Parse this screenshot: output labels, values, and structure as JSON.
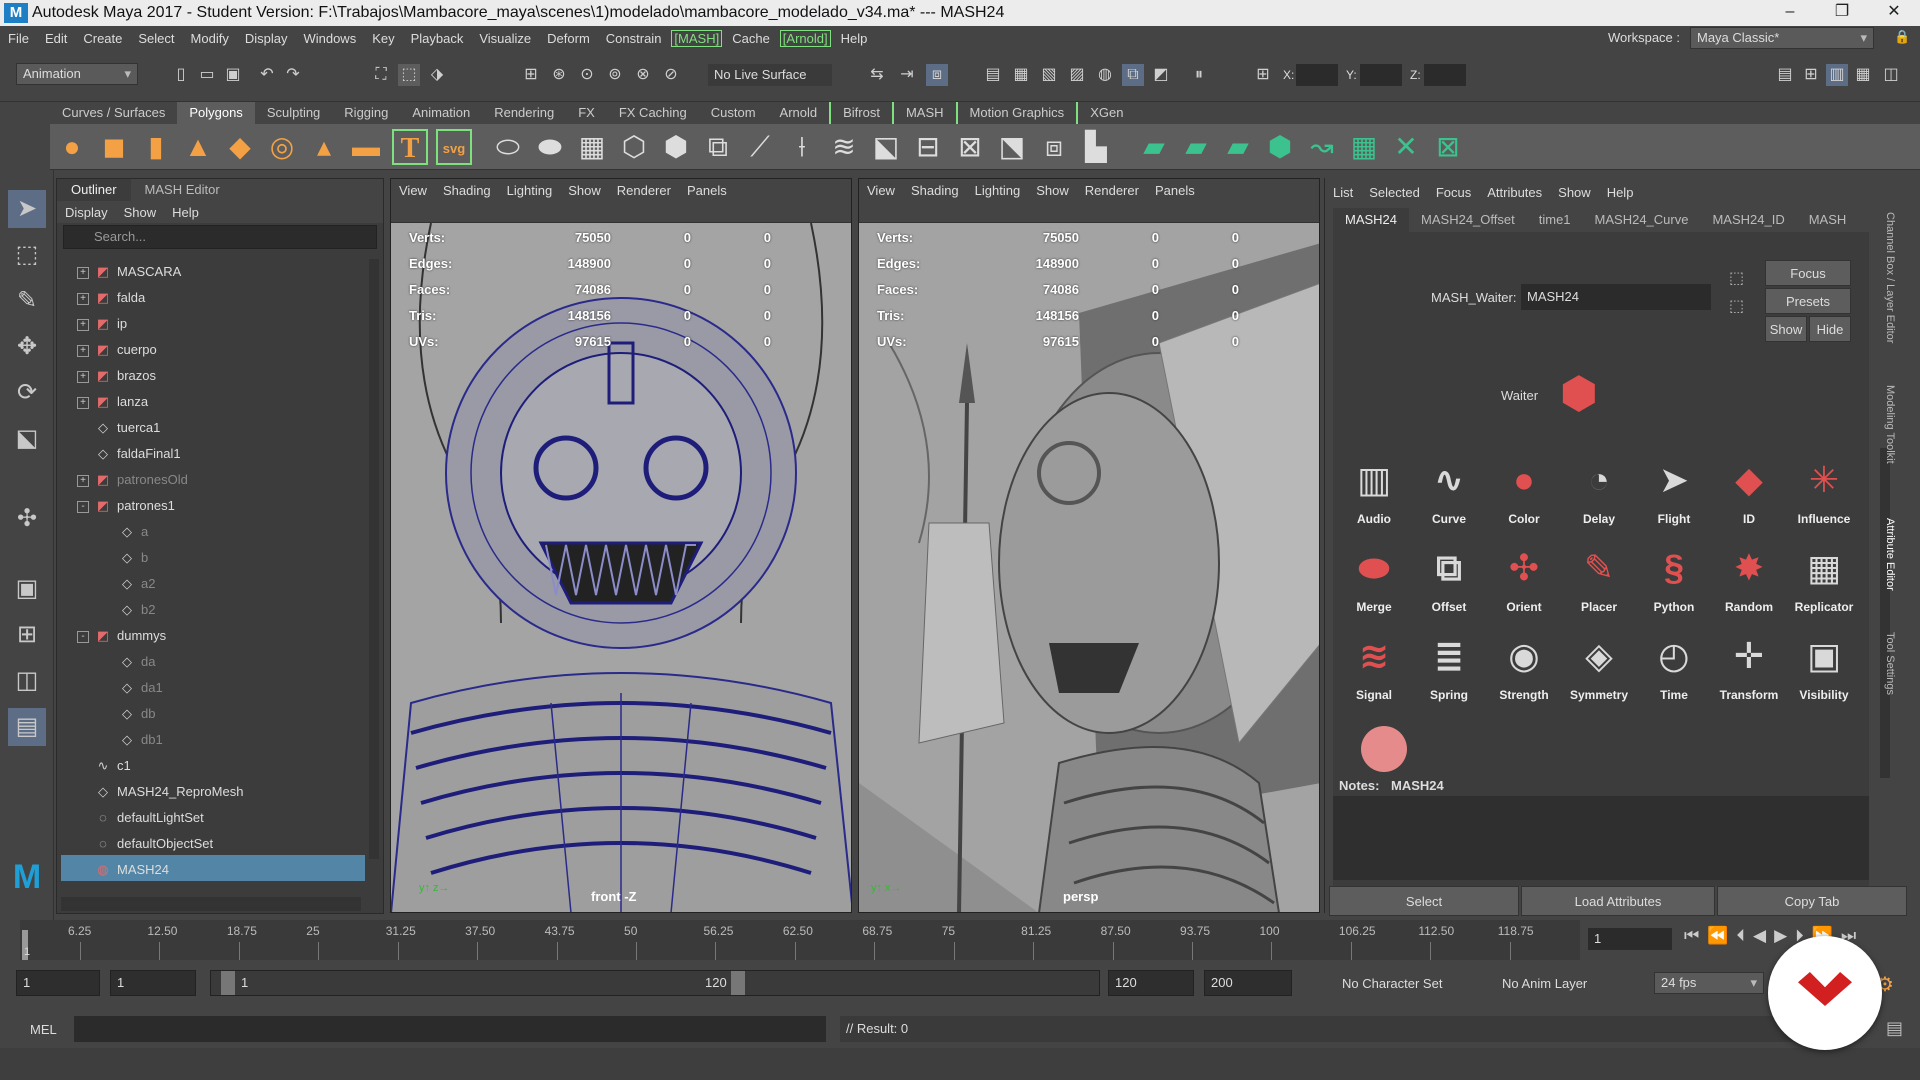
{
  "window": {
    "title": "Autodesk Maya 2017 - Student Version: F:\\Trabajos\\Mambacore_maya\\scenes\\1)modelado\\mambacore_modelado_v34.ma*   ---   MASH24",
    "app_logo": "M"
  },
  "menubar": {
    "items": [
      "File",
      "Edit",
      "Create",
      "Select",
      "Modify",
      "Display",
      "Windows",
      "Key",
      "Playback",
      "Visualize",
      "Deform",
      "Constrain",
      "[MASH]",
      "Cache",
      "[Arnold]",
      "Help"
    ]
  },
  "status": {
    "menuset": "Animation",
    "live_surface": "No Live Surface",
    "workspace_label": "Workspace :",
    "workspace_value": "Maya Classic*",
    "x_label": "X:",
    "y_label": "Y:",
    "z_label": "Z:"
  },
  "shelf": {
    "tabs": [
      "Curves / Surfaces",
      "Polygons",
      "Sculpting",
      "Rigging",
      "Animation",
      "Rendering",
      "FX",
      "FX Caching",
      "Custom",
      "Arnold",
      "Bifrost",
      "MASH",
      "Motion Graphics",
      "XGen"
    ],
    "active_tab": "Polygons",
    "text_icon": "T",
    "svg_icon": "svg"
  },
  "outliner": {
    "tabs": [
      "Outliner",
      "MASH Editor"
    ],
    "menu": [
      "Display",
      "Show",
      "Help"
    ],
    "search_placeholder": "Search...",
    "items": [
      {
        "label": "MASCARA",
        "indent": 0,
        "expand": "+",
        "type": "group",
        "dim": false
      },
      {
        "label": "falda",
        "indent": 0,
        "expand": "+",
        "type": "group",
        "dim": false
      },
      {
        "label": "ip",
        "indent": 0,
        "expand": "+",
        "type": "group",
        "dim": false
      },
      {
        "label": "cuerpo",
        "indent": 0,
        "expand": "+",
        "type": "group",
        "dim": false
      },
      {
        "label": "brazos",
        "indent": 0,
        "expand": "+",
        "type": "group",
        "dim": false
      },
      {
        "label": "lanza",
        "indent": 0,
        "expand": "+",
        "type": "group",
        "dim": false
      },
      {
        "label": "tuerca1",
        "indent": 0,
        "expand": "",
        "type": "mesh",
        "dim": false
      },
      {
        "label": "faldaFinal1",
        "indent": 0,
        "expand": "",
        "type": "mesh",
        "dim": false
      },
      {
        "label": "patronesOld",
        "indent": 0,
        "expand": "+",
        "type": "group",
        "dim": true
      },
      {
        "label": "patrones1",
        "indent": 0,
        "expand": "-",
        "type": "group",
        "dim": false
      },
      {
        "label": "a",
        "indent": 1,
        "expand": "",
        "type": "mesh",
        "dim": true
      },
      {
        "label": "b",
        "indent": 1,
        "expand": "",
        "type": "mesh",
        "dim": true
      },
      {
        "label": "a2",
        "indent": 1,
        "expand": "",
        "type": "mesh",
        "dim": true
      },
      {
        "label": "b2",
        "indent": 1,
        "expand": "",
        "type": "mesh",
        "dim": true
      },
      {
        "label": "dummys",
        "indent": 0,
        "expand": "-",
        "type": "group",
        "dim": false
      },
      {
        "label": "da",
        "indent": 1,
        "expand": "",
        "type": "mesh",
        "dim": true
      },
      {
        "label": "da1",
        "indent": 1,
        "expand": "",
        "type": "mesh",
        "dim": true
      },
      {
        "label": "db",
        "indent": 1,
        "expand": "",
        "type": "mesh",
        "dim": true
      },
      {
        "label": "db1",
        "indent": 1,
        "expand": "",
        "type": "mesh",
        "dim": true
      },
      {
        "label": "c1",
        "indent": 0,
        "expand": "",
        "type": "curve",
        "dim": false
      },
      {
        "label": "MASH24_ReproMesh",
        "indent": 0,
        "expand": "",
        "type": "mesh",
        "dim": false
      },
      {
        "label": "defaultLightSet",
        "indent": 0,
        "expand": "",
        "type": "set",
        "dim": false
      },
      {
        "label": "defaultObjectSet",
        "indent": 0,
        "expand": "",
        "type": "set",
        "dim": false
      },
      {
        "label": "MASH24",
        "indent": 0,
        "expand": "",
        "type": "mash",
        "dim": false
      }
    ],
    "selected": "MASH24"
  },
  "viewports": {
    "menu": [
      "View",
      "Shading",
      "Lighting",
      "Show",
      "Renderer",
      "Panels"
    ],
    "hud": [
      {
        "k": "Verts:",
        "v": "75050",
        "a": "0",
        "b": "0"
      },
      {
        "k": "Edges:",
        "v": "148900",
        "a": "0",
        "b": "0"
      },
      {
        "k": "Faces:",
        "v": "74086",
        "a": "0",
        "b": "0"
      },
      {
        "k": "Tris:",
        "v": "148156",
        "a": "0",
        "b": "0"
      },
      {
        "k": "UVs:",
        "v": "97615",
        "a": "0",
        "b": "0"
      }
    ],
    "left_label": "front -Z",
    "right_label": "persp"
  },
  "attribute_editor": {
    "menu": [
      "List",
      "Selected",
      "Focus",
      "Attributes",
      "Show",
      "Help"
    ],
    "tabs": [
      "MASH24",
      "MASH24_Offset",
      "time1",
      "MASH24_Curve",
      "MASH24_ID",
      "MASH"
    ],
    "active_tab": "MASH24",
    "field_label": "MASH_Waiter:",
    "field_value": "MASH24",
    "focus_btn": "Focus",
    "presets_btn": "Presets",
    "show_btn": "Show",
    "hide_btn": "Hide",
    "waiter_label": "Waiter",
    "nodes": [
      {
        "label": "Audio",
        "icon": "▥"
      },
      {
        "label": "Curve",
        "icon": "∿"
      },
      {
        "label": "Color",
        "icon": "●"
      },
      {
        "label": "Delay",
        "icon": "◔"
      },
      {
        "label": "Flight",
        "icon": "➤"
      },
      {
        "label": "ID",
        "icon": "◆"
      },
      {
        "label": "Influence",
        "icon": "✳"
      },
      {
        "label": "Merge",
        "icon": "⬬"
      },
      {
        "label": "Offset",
        "icon": "⧉"
      },
      {
        "label": "Orient",
        "icon": "✣"
      },
      {
        "label": "Placer",
        "icon": "✎"
      },
      {
        "label": "Python",
        "icon": "§"
      },
      {
        "label": "Random",
        "icon": "✸"
      },
      {
        "label": "Replicator",
        "icon": "▦"
      },
      {
        "label": "Signal",
        "icon": "≋"
      },
      {
        "label": "Spring",
        "icon": "≣"
      },
      {
        "label": "Strength",
        "icon": "◉"
      },
      {
        "label": "Symmetry",
        "icon": "◈"
      },
      {
        "label": "Time",
        "icon": "◴"
      },
      {
        "label": "Transform",
        "icon": "✛"
      },
      {
        "label": "Visibility",
        "icon": "▣"
      }
    ],
    "notes_label": "Notes:",
    "notes_value": "MASH24",
    "select_btn": "Select",
    "load_btn": "Load Attributes",
    "copy_btn": "Copy Tab",
    "side_tabs": [
      "Channel Box / Layer Editor",
      "Modeling Toolkit",
      "Attribute Editor",
      "Tool Settings"
    ]
  },
  "timeline": {
    "ticks": [
      "6.25",
      "12.50",
      "18.75",
      "25",
      "31.25",
      "37.50",
      "43.75",
      "50",
      "56.25",
      "62.50",
      "68.75",
      "75",
      "81.25",
      "87.50",
      "93.75",
      "100",
      "106.25",
      "112.50",
      "118.75"
    ],
    "current_frame": "1",
    "frame_field": "1"
  },
  "range": {
    "start": "1",
    "inner_start": "1",
    "slider_start": "1",
    "slider_end": "120",
    "end": "120",
    "anim_end": "200",
    "character_set": "No Character Set",
    "anim_layer": "No Anim Layer",
    "fps": "24 fps"
  },
  "cmdline": {
    "lang": "MEL",
    "result": "// Result: 0"
  },
  "colors": {
    "accent": "#5285a6",
    "mash_red": "#e05050",
    "shelf_orange": "#f3a144"
  }
}
